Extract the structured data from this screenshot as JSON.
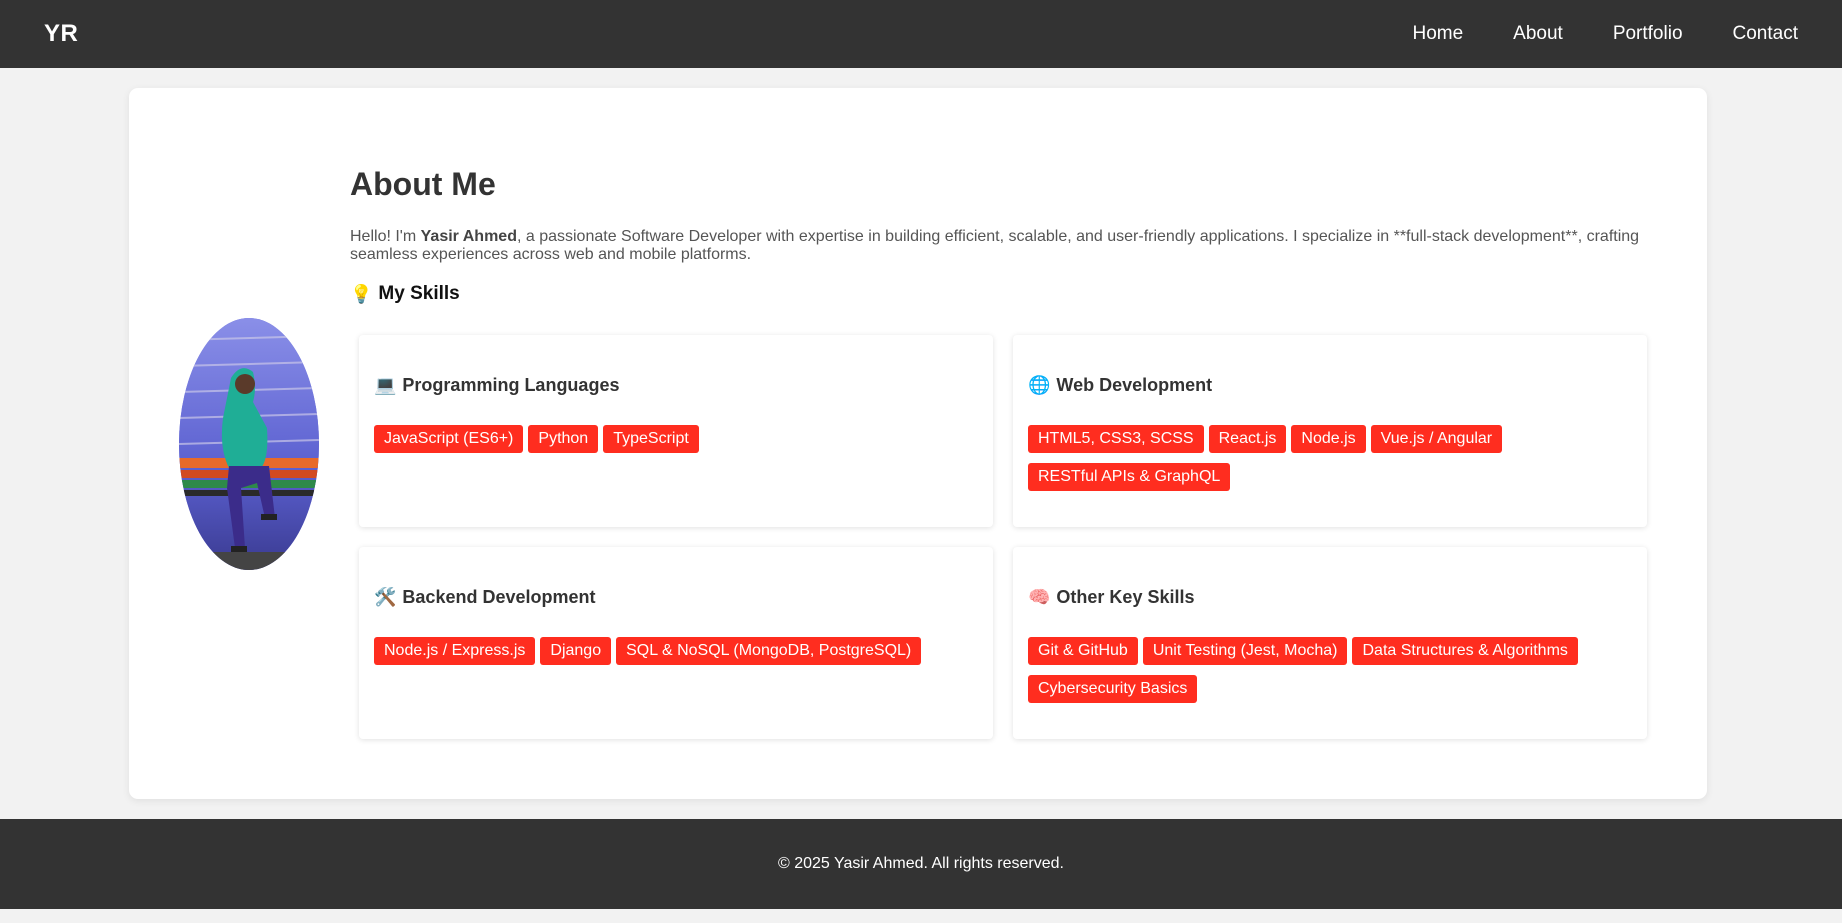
{
  "navbar": {
    "logo": "YR",
    "links": [
      {
        "label": "Home"
      },
      {
        "label": "About"
      },
      {
        "label": "Portfolio"
      },
      {
        "label": "Contact"
      }
    ]
  },
  "about": {
    "title": "About Me",
    "intro_prefix": "Hello! I'm ",
    "intro_name": "Yasir Ahmed",
    "intro_suffix": ", a passionate Software Developer with expertise in building efficient, scalable, and user-friendly applications. I specialize in **full-stack development**, crafting seamless experiences across web and mobile platforms.",
    "skills_icon": "💡",
    "skills_heading": "My Skills"
  },
  "skill_cards": [
    {
      "icon": "💻",
      "title": "Programming Languages",
      "tags": [
        "JavaScript (ES6+)",
        "Python",
        "TypeScript"
      ]
    },
    {
      "icon": "🌐",
      "title": "Web Development",
      "tags": [
        "HTML5, CSS3, SCSS",
        "React.js",
        "Node.js",
        "Vue.js / Angular",
        "RESTful APIs & GraphQL"
      ]
    },
    {
      "icon": "🛠️",
      "title": "Backend Development",
      "tags": [
        "Node.js / Express.js",
        "Django",
        "SQL & NoSQL (MongoDB, PostgreSQL)"
      ]
    },
    {
      "icon": "🧠",
      "title": "Other Key Skills",
      "tags": [
        "Git & GitHub",
        "Unit Testing (Jest, Mocha)",
        "Data Structures & Algorithms",
        "Cybersecurity Basics"
      ]
    }
  ],
  "footer": {
    "text": "© 2025 Yasir Ahmed. All rights reserved."
  },
  "colors": {
    "nav_bg": "#333333",
    "tag_bg": "#ff2d1f",
    "page_bg": "#f2f2f2"
  }
}
